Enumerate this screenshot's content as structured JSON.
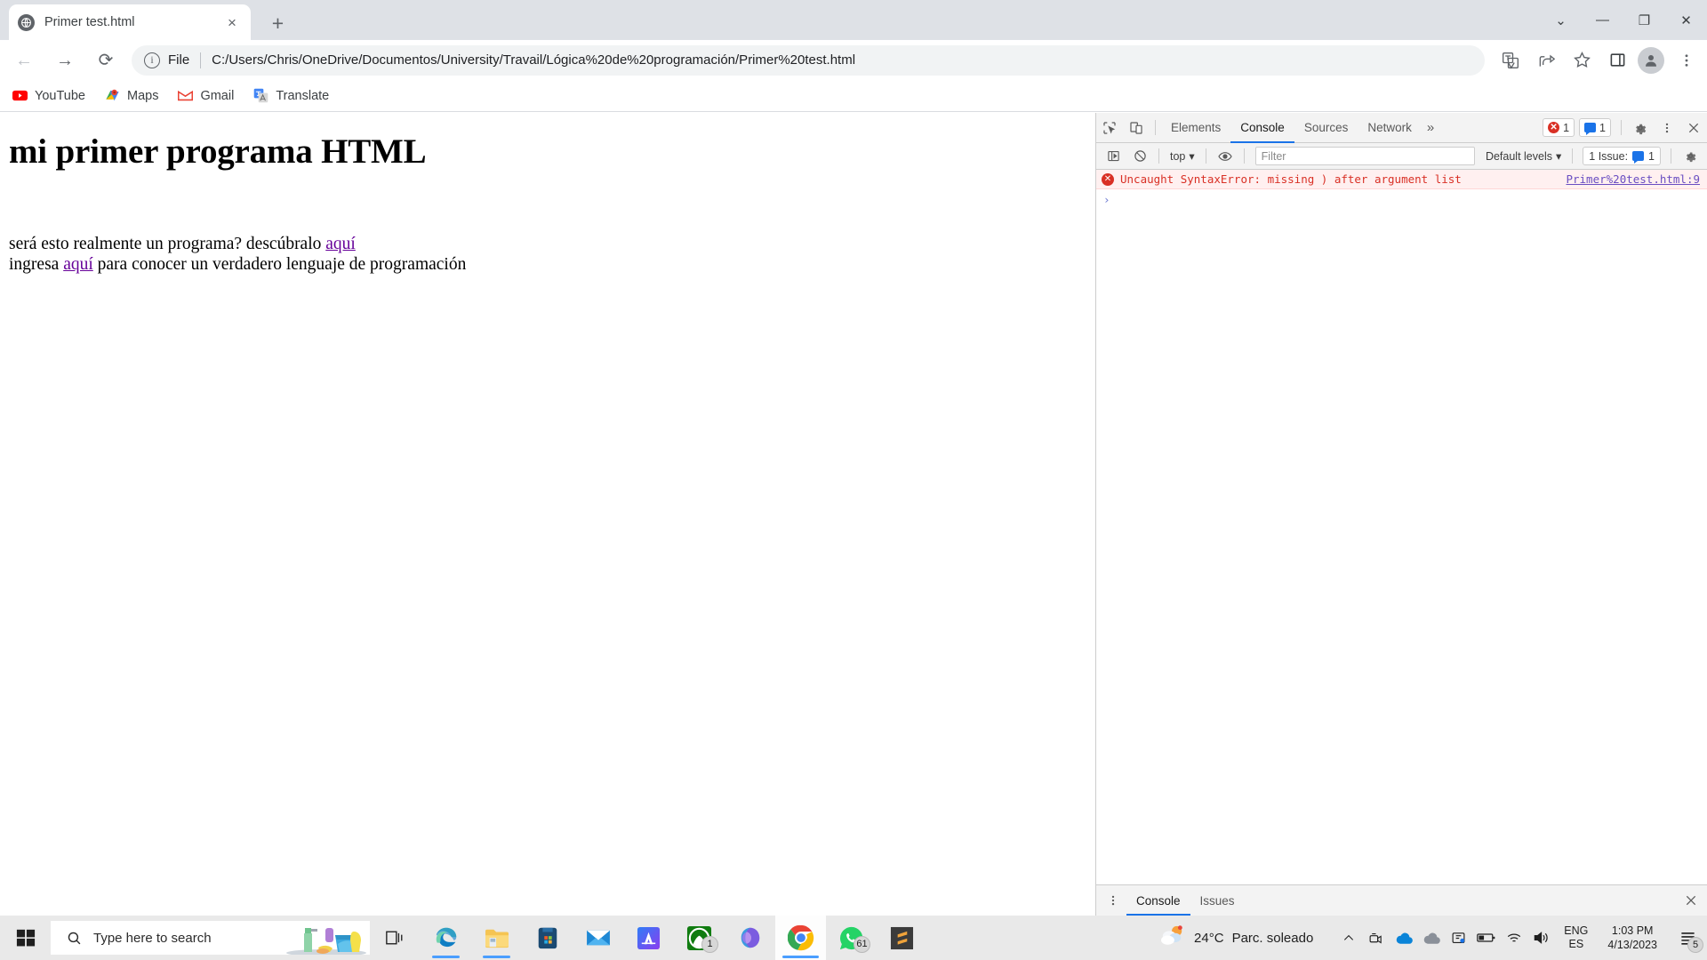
{
  "browser": {
    "tab": {
      "title": "Primer test.html",
      "favicon": "globe-icon",
      "close": "×"
    },
    "newtab_label": "+",
    "caption": {
      "minimize": "—",
      "maximize": "❐",
      "close": "✕",
      "chevron": "⌄"
    },
    "nav": {
      "back": "←",
      "forward": "→",
      "reload": "⟳"
    },
    "omnibox": {
      "info_icon": "info-icon",
      "scheme_label": "File",
      "url": "C:/Users/Chris/OneDrive/Documentos/University/Travail/Lógica%20de%20programación/Primer%20test.html"
    },
    "toolbar_icons": [
      "translate-icon",
      "share-icon",
      "bookmark-star-icon",
      "side-panel-icon",
      "profile-avatar-icon",
      "chrome-menu-icon"
    ],
    "bookmarks": [
      {
        "label": "YouTube",
        "icon": "youtube-icon"
      },
      {
        "label": "Maps",
        "icon": "google-maps-icon"
      },
      {
        "label": "Gmail",
        "icon": "gmail-icon"
      },
      {
        "label": "Translate",
        "icon": "google-translate-icon"
      }
    ]
  },
  "page": {
    "heading": "mi primer programa HTML",
    "line1_before": "será esto realmente un programa? descúbralo ",
    "line1_link": "aquí",
    "line2_before": "ingresa ",
    "line2_link": "aquí",
    "line2_after": " para conocer un verdadero lenguaje de programación",
    "link_color": "#660099"
  },
  "devtools": {
    "inspect_icon": "inspect-element-icon",
    "device_icon": "device-toolbar-icon",
    "tabs": [
      {
        "label": "Elements",
        "active": false
      },
      {
        "label": "Console",
        "active": true
      },
      {
        "label": "Sources",
        "active": false
      },
      {
        "label": "Network",
        "active": false
      }
    ],
    "more_tabs": "»",
    "error_badge_count": "1",
    "message_badge_count": "1",
    "settings_icon": "gear-icon",
    "menu_icon": "kebab-menu-icon",
    "close_icon": "close-icon",
    "console_toolbar": {
      "sidebar_icon": "console-sidebar-icon",
      "clear_icon": "clear-console-icon",
      "context": "top",
      "context_caret": "▾",
      "eye_icon": "live-expression-icon",
      "filter_placeholder": "Filter",
      "filter_value": "",
      "levels_label": "Default levels",
      "levels_caret": "▾",
      "issues_label": "1 Issue:",
      "issues_count": "1",
      "settings_icon": "gear-icon"
    },
    "messages": [
      {
        "type": "error",
        "icon": "error-icon",
        "text": "Uncaught SyntaxError: missing ) after argument list",
        "source": "Primer%20test.html:9"
      }
    ],
    "prompt_arrow": "›",
    "drawer": {
      "menu_icon": "kebab-menu-icon",
      "tabs": [
        {
          "label": "Console",
          "active": true
        },
        {
          "label": "Issues",
          "active": false
        }
      ],
      "close_icon": "close-icon"
    },
    "accent_color": "#1a73e8",
    "error_color": "#d93025"
  },
  "taskbar": {
    "start_icon": "windows-start-icon",
    "search": {
      "icon": "search-icon",
      "placeholder": "Type here to search",
      "value": ""
    },
    "apps": [
      {
        "name": "task-view",
        "badge": "",
        "active": false,
        "running": false
      },
      {
        "name": "microsoft-edge",
        "badge": "",
        "active": false,
        "running": true
      },
      {
        "name": "file-explorer",
        "badge": "",
        "active": false,
        "running": true
      },
      {
        "name": "microsoft-store",
        "badge": "",
        "active": false,
        "running": false
      },
      {
        "name": "mail",
        "badge": "",
        "active": false,
        "running": false
      },
      {
        "name": "autodesk-app",
        "badge": "",
        "active": false,
        "running": false
      },
      {
        "name": "xbox",
        "badge": "1",
        "active": false,
        "running": false
      },
      {
        "name": "microsoft-365",
        "badge": "",
        "active": false,
        "running": false
      },
      {
        "name": "google-chrome",
        "badge": "",
        "active": true,
        "running": true
      },
      {
        "name": "whatsapp",
        "badge": "61",
        "active": false,
        "running": false
      },
      {
        "name": "sublime-text",
        "badge": "",
        "active": false,
        "running": false
      }
    ],
    "weather": {
      "icon": "partly-cloudy-icon",
      "temperature": "24°C",
      "condition": "Parc. soleado"
    },
    "tray_icons": [
      "show-hidden-icons-chevron",
      "meet-now-icon",
      "onedrive-icon",
      "onedrive-gray-icon",
      "graphics-settings-icon",
      "battery-icon",
      "wifi-icon",
      "volume-icon"
    ],
    "language": {
      "primary": "ENG",
      "secondary": "ES"
    },
    "clock": {
      "time": "1:03 PM",
      "date": "4/13/2023"
    },
    "notifications": {
      "icon": "notification-icon",
      "count": "5"
    }
  }
}
